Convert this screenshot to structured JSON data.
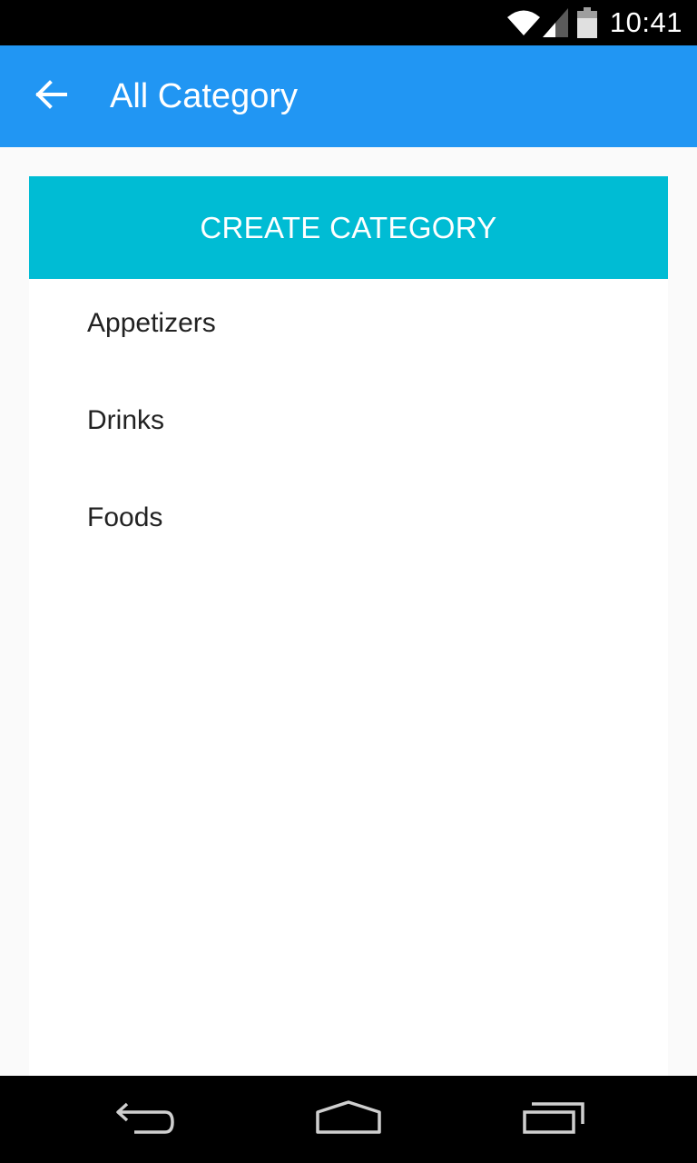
{
  "status_bar": {
    "time": "10:41",
    "icons": [
      "wifi-icon",
      "signal-icon",
      "battery-icon"
    ]
  },
  "app_bar": {
    "title": "All Category",
    "back_icon": "arrow-back-icon",
    "color": "#2196f3"
  },
  "main": {
    "create_button_label": "CREATE CATEGORY",
    "create_button_color": "#00bcd4",
    "categories": [
      {
        "label": "Appetizers"
      },
      {
        "label": "Drinks"
      },
      {
        "label": "Foods"
      }
    ]
  },
  "nav_bar": {
    "icons": [
      "nav-back-icon",
      "nav-home-icon",
      "nav-recents-icon"
    ]
  }
}
